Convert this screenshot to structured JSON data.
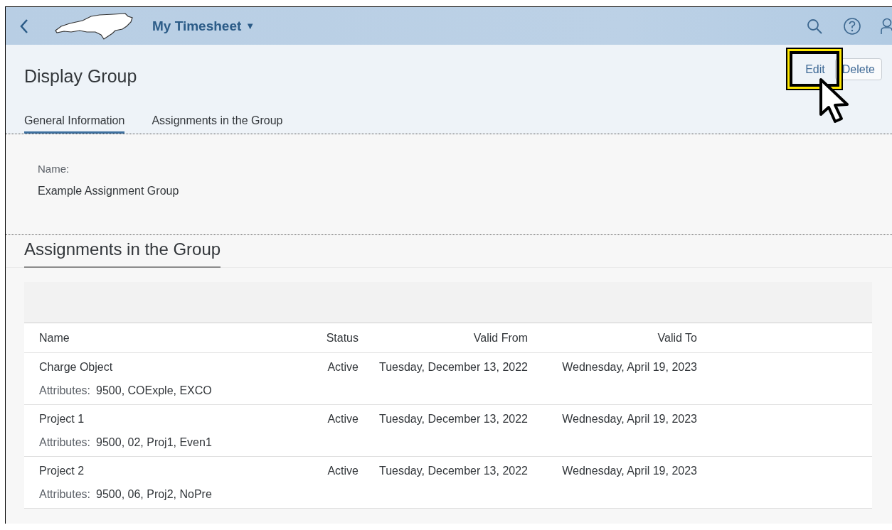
{
  "shell_bar": {
    "title": "My Timesheet",
    "dropdown_glyph": "▼"
  },
  "header": {
    "title": "Display Group",
    "actions": [
      {
        "label": "Edit",
        "highlighted": true
      },
      {
        "label": "Delete",
        "highlighted": false
      }
    ]
  },
  "tabs": [
    {
      "label": "General Information",
      "selected": true
    },
    {
      "label": "Assignments in the Group",
      "selected": false
    }
  ],
  "general": {
    "label": "Name:",
    "value": "Example Assignment Group"
  },
  "section": {
    "title": "Assignments in the Group"
  },
  "table": {
    "columns": [
      "Name",
      "Status",
      "Valid From",
      "Valid To"
    ],
    "rows": [
      {
        "name": "Charge Object",
        "status": "Active",
        "valid_from": "Tuesday, December 13, 2022",
        "valid_to": "Wednesday, April 19, 2023",
        "attributes_label": "Attributes:",
        "attributes": "9500, COExple, EXCO"
      },
      {
        "name": "Project 1",
        "status": "Active",
        "valid_from": "Tuesday, December 13, 2022",
        "valid_to": "Wednesday, April 19, 2023",
        "attributes_label": "Attributes:",
        "attributes": "9500, 02, Proj1, Even1"
      },
      {
        "name": "Project 2",
        "status": "Active",
        "valid_from": "Tuesday, December 13, 2022",
        "valid_to": "Wednesday, April 19, 2023",
        "attributes_label": "Attributes:",
        "attributes": "9500, 06, Proj2, NoPre"
      }
    ]
  }
}
